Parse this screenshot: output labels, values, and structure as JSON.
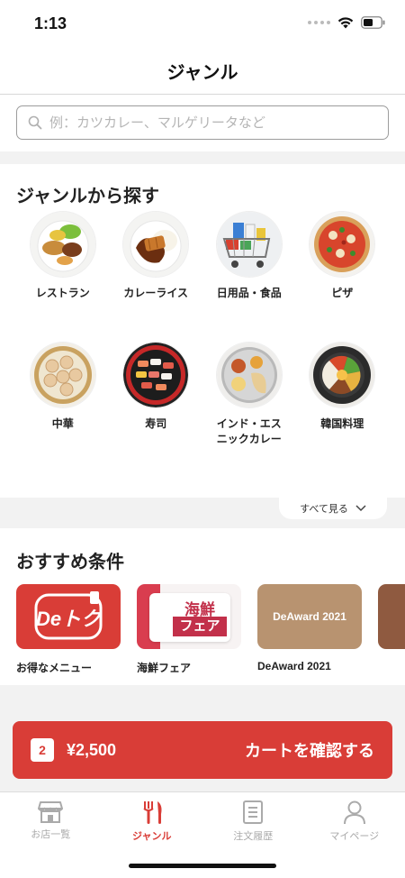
{
  "status": {
    "time": "1:13"
  },
  "nav": {
    "title": "ジャンル"
  },
  "search": {
    "placeholder": "例：カツカレー、マルゲリータなど"
  },
  "genres": {
    "title": "ジャンルから探す",
    "items": [
      {
        "label": "レストラン",
        "icon": "restaurant-plate"
      },
      {
        "label": "カレーライス",
        "icon": "curry-rice-plate"
      },
      {
        "label": "日用品・食品",
        "icon": "shopping-cart"
      },
      {
        "label": "ピザ",
        "icon": "pizza"
      },
      {
        "label": "中華",
        "icon": "dim-sum-steamer"
      },
      {
        "label": "寿司",
        "icon": "sushi-platter"
      },
      {
        "label": "インド・エスニックカレー",
        "icon": "indian-thali"
      },
      {
        "label": "韓国料理",
        "icon": "bibimbap-bowl"
      }
    ],
    "see_all": "すべて見る"
  },
  "recommendations": {
    "title": "おすすめ条件",
    "items": [
      {
        "label": "お得なメニュー",
        "card_text": "Deトク",
        "color": "#d93d37"
      },
      {
        "label": "海鮮フェア",
        "card_text_top": "海鮮",
        "card_text_bottom": "フェア",
        "color": "#d93d4f"
      },
      {
        "label": "DeAward 2021",
        "card_text": "DeAward 2021",
        "color": "#b89370"
      },
      {
        "label": "",
        "card_text": "",
        "color": "#8f5a40"
      }
    ]
  },
  "cart": {
    "count": "2",
    "price": "¥2,500",
    "cta": "カートを確認する"
  },
  "tabs": [
    {
      "label": "お店一覧",
      "icon": "store-icon",
      "active": false
    },
    {
      "label": "ジャンル",
      "icon": "fork-knife-icon",
      "active": true
    },
    {
      "label": "注文履歴",
      "icon": "receipt-icon",
      "active": false
    },
    {
      "label": "マイページ",
      "icon": "person-icon",
      "active": false
    }
  ],
  "colors": {
    "accent": "#d93d37",
    "band": "#f2f2f2"
  }
}
